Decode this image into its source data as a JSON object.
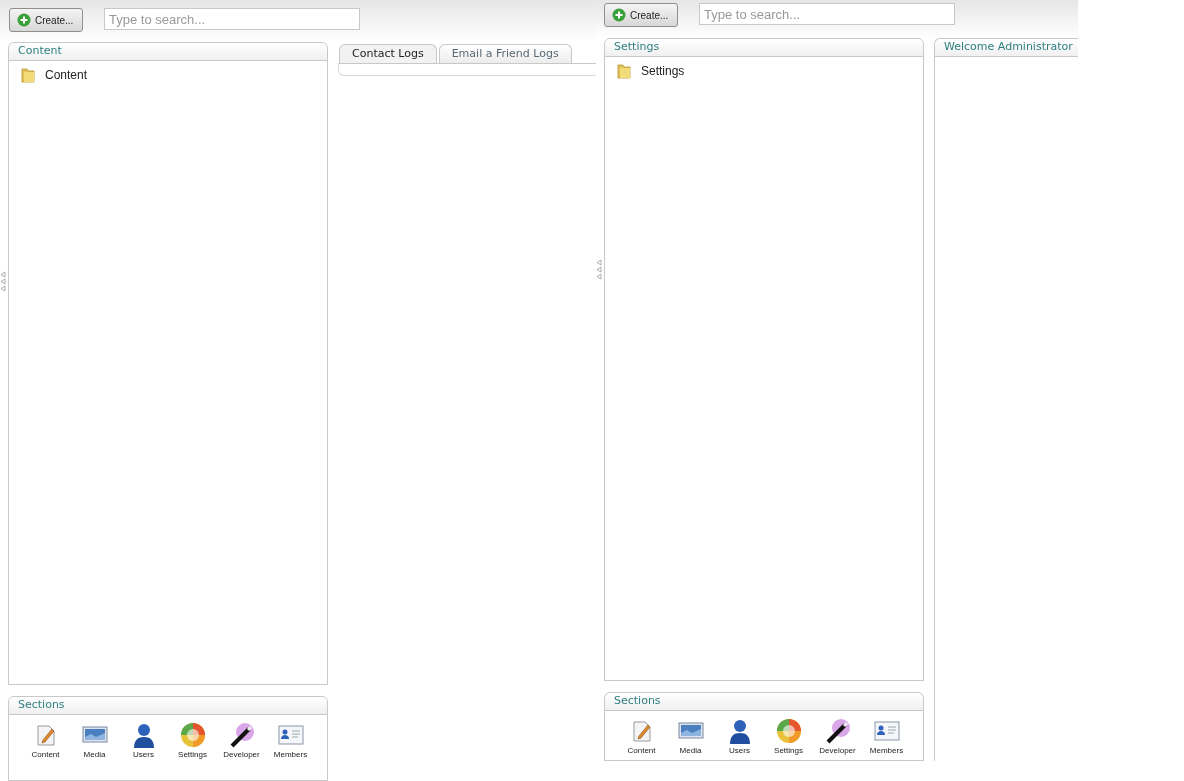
{
  "frames": [
    {
      "create_button": "Create...",
      "search": {
        "placeholder": "Type to search..."
      },
      "tree": {
        "title": "Content",
        "items": [
          {
            "label": "Content"
          }
        ]
      },
      "sections": {
        "title": "Sections",
        "items": [
          {
            "kind": "content",
            "label": "Content"
          },
          {
            "kind": "media",
            "label": "Media"
          },
          {
            "kind": "users",
            "label": "Users"
          },
          {
            "kind": "settings",
            "label": "Settings"
          },
          {
            "kind": "developer",
            "label": "Developer"
          },
          {
            "kind": "members",
            "label": "Members"
          }
        ]
      },
      "main": {
        "kind": "tabs",
        "tabs": [
          {
            "label": "Contact Logs",
            "selected": true
          },
          {
            "label": "Email a Friend Logs",
            "selected": false
          }
        ]
      }
    },
    {
      "create_button": "Create...",
      "search": {
        "placeholder": "Type to search..."
      },
      "tree": {
        "title": "Settings",
        "items": [
          {
            "label": "Settings"
          }
        ]
      },
      "sections": {
        "title": "Sections",
        "items": [
          {
            "kind": "content",
            "label": "Content"
          },
          {
            "kind": "media",
            "label": "Media"
          },
          {
            "kind": "users",
            "label": "Users"
          },
          {
            "kind": "settings",
            "label": "Settings"
          },
          {
            "kind": "developer",
            "label": "Developer"
          },
          {
            "kind": "members",
            "label": "Members"
          }
        ]
      },
      "main": {
        "kind": "panel",
        "title": "Welcome Administrator"
      }
    }
  ]
}
